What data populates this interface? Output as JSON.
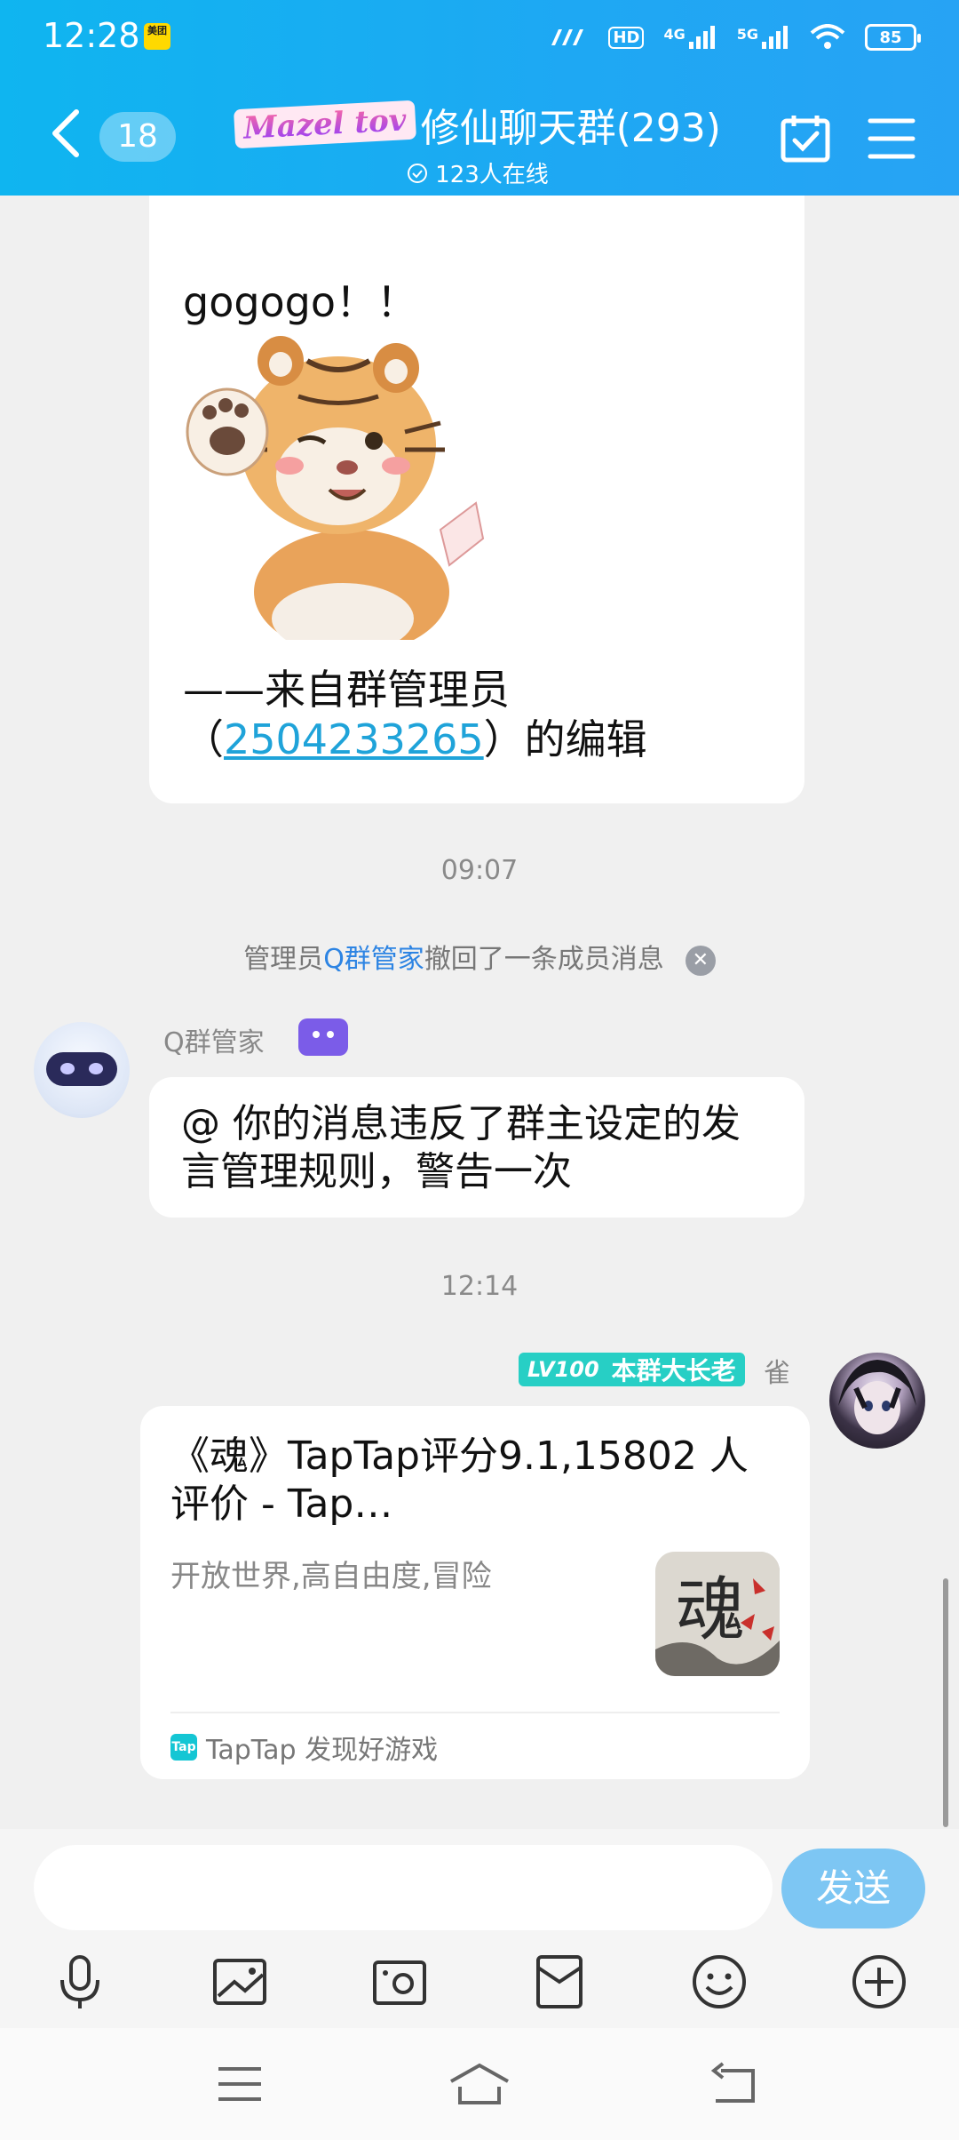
{
  "status_bar": {
    "time": "12:28",
    "app_badge": "美团",
    "signal_labels": [
      "HD",
      "4G",
      "5G"
    ],
    "battery": "85"
  },
  "nav": {
    "unread_count": "18",
    "logo_text": "Mazel tov",
    "title": "修仙聊天群(293)",
    "online": "123人在线"
  },
  "messages": {
    "msg1": {
      "text": "gogogo！！",
      "footer_prefix": "——来自群管理员",
      "footer_open": "（",
      "qq_number": "2504233265",
      "footer_close": "）的编辑"
    },
    "time1": "09:07",
    "notice": {
      "prefix": "管理员",
      "admin": "Q群管家",
      "suffix": "撤回了一条成员消息",
      "close_glyph": "✕"
    },
    "msg2": {
      "sender": "Q群管家",
      "text": "@ 你的消息违反了群主设定的发言管理规则，警告一次"
    },
    "time2": "12:14",
    "msg3": {
      "level": "LV100",
      "title_badge": "本群大长老",
      "sender": "雀",
      "card_title": "《魂》TapTap评分9.1,15802 人评价 - Tap…",
      "card_desc": "开放世界,高自由度,冒险",
      "thumb_char": "魂",
      "source_icon": "Tap",
      "source": "TapTap 发现好游戏"
    }
  },
  "input": {
    "value": "",
    "send_label": "发送"
  },
  "colors": {
    "header_blue": "#1ea8f3",
    "link_blue": "#1fa3d9",
    "send_button": "#7dc6f3",
    "level_teal": "#27cfc5"
  },
  "icons": [
    "back-arrow-icon",
    "calendar-check-icon",
    "menu-icon",
    "microphone-icon",
    "image-icon",
    "camera-icon",
    "red-packet-icon",
    "emoji-icon",
    "plus-icon"
  ]
}
